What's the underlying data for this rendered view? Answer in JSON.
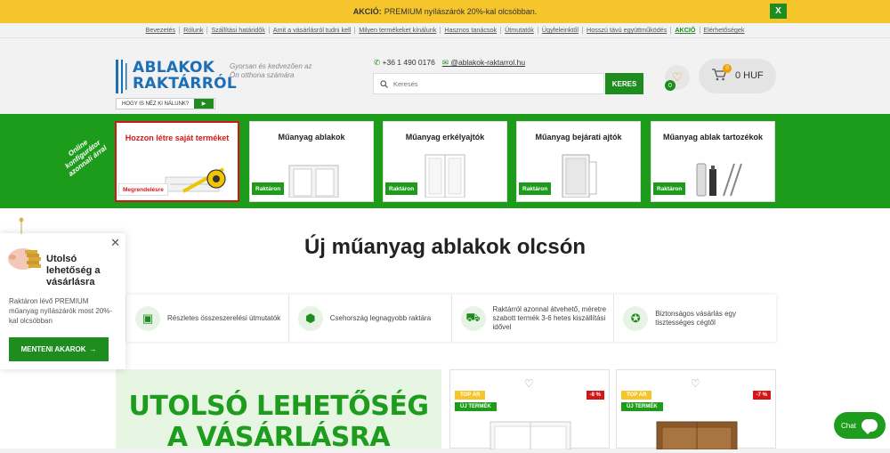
{
  "topbar": {
    "strong": "AKCIÓ:",
    "text": "PREMIUM nyílászárók 20%-kal olcsóbban.",
    "close_label": "X"
  },
  "navlinks": [
    {
      "label": "Bevezetés",
      "highlight": false
    },
    {
      "label": "Rólunk",
      "highlight": false
    },
    {
      "label": "Szállítási határidők",
      "highlight": false
    },
    {
      "label": "Amit a vásárlásról tudni kell",
      "highlight": false
    },
    {
      "label": "Milyen termékeket kínálunk",
      "highlight": false
    },
    {
      "label": "Hasznos tanácsok",
      "highlight": false
    },
    {
      "label": "Útmutatók",
      "highlight": false
    },
    {
      "label": "Ügyfeleinktől",
      "highlight": false
    },
    {
      "label": "Hosszú távú együttműködés",
      "highlight": false
    },
    {
      "label": "AKCIÓ",
      "highlight": true
    },
    {
      "label": "Elérhetőségek",
      "highlight": false
    }
  ],
  "header": {
    "logo_line1": "ABLAKOK",
    "logo_line2": "RAKTÁRRÓL",
    "slogan": "Gyorsan és kedvezően az Ön otthona számára",
    "who_button": "HOGY IS NÉZ KI NÁLUNK?",
    "phone": "+36 1 490 0176",
    "email": "ablakok-raktarrol.hu",
    "email_prefix": "@",
    "search_placeholder": "Keresés",
    "search_button": "KERES",
    "fav_count": "0",
    "cart_count": "0",
    "cart_amount": "0 HUF"
  },
  "configurator_label": "Online konfigurátor azonnali árral",
  "categories": [
    {
      "title": "Hozzon létre saját terméket",
      "badge": "Megrendelésre"
    },
    {
      "title": "Műanyag ablakok",
      "badge": "Raktáron"
    },
    {
      "title": "Műanyag erkélyajtók",
      "badge": "Raktáron"
    },
    {
      "title": "Műanyag bejárati ajtók",
      "badge": "Raktáron"
    },
    {
      "title": "Műanyag ablak tartozékok",
      "badge": "Raktáron"
    }
  ],
  "main_title": "Új műanyag ablakok olcsón",
  "features": [
    {
      "icon": "instructions-icon",
      "text": "Részletes összeszerelési útmutatók"
    },
    {
      "icon": "box-icon",
      "text": "Csehország legnagyobb raktára"
    },
    {
      "icon": "truck-icon",
      "text": "Raktárról azonnal átvehető, méretre szabott termék 3-6 hetes kiszállítási idővel"
    },
    {
      "icon": "badge-icon",
      "text": "Biztonságos vásárlás egy tisztességes cégtől"
    }
  ],
  "promo": {
    "line1": "UTOLSÓ LEHETŐSÉG",
    "line2": "A VÁSÁRLÁSRA"
  },
  "products": [
    {
      "top": "TOP ÁR",
      "new": "ÚJ TERMÉK",
      "discount": "-8 %"
    },
    {
      "top": "TOP ÁR",
      "new": "ÚJ TERMÉK",
      "discount": "-7 %"
    }
  ],
  "popup": {
    "title": "Utolsó lehetőség a vásárlásra",
    "description": "Raktáron lévő PREMIUM műanyag nyílászárók most 20%-kal olcsóbban",
    "button": "MENTENI AKAROK"
  },
  "chat_label": "Chat",
  "colors": {
    "green": "#1d9c1b",
    "yellow": "#f6c42b",
    "red": "#d31717",
    "blue": "#1d6fb5"
  }
}
